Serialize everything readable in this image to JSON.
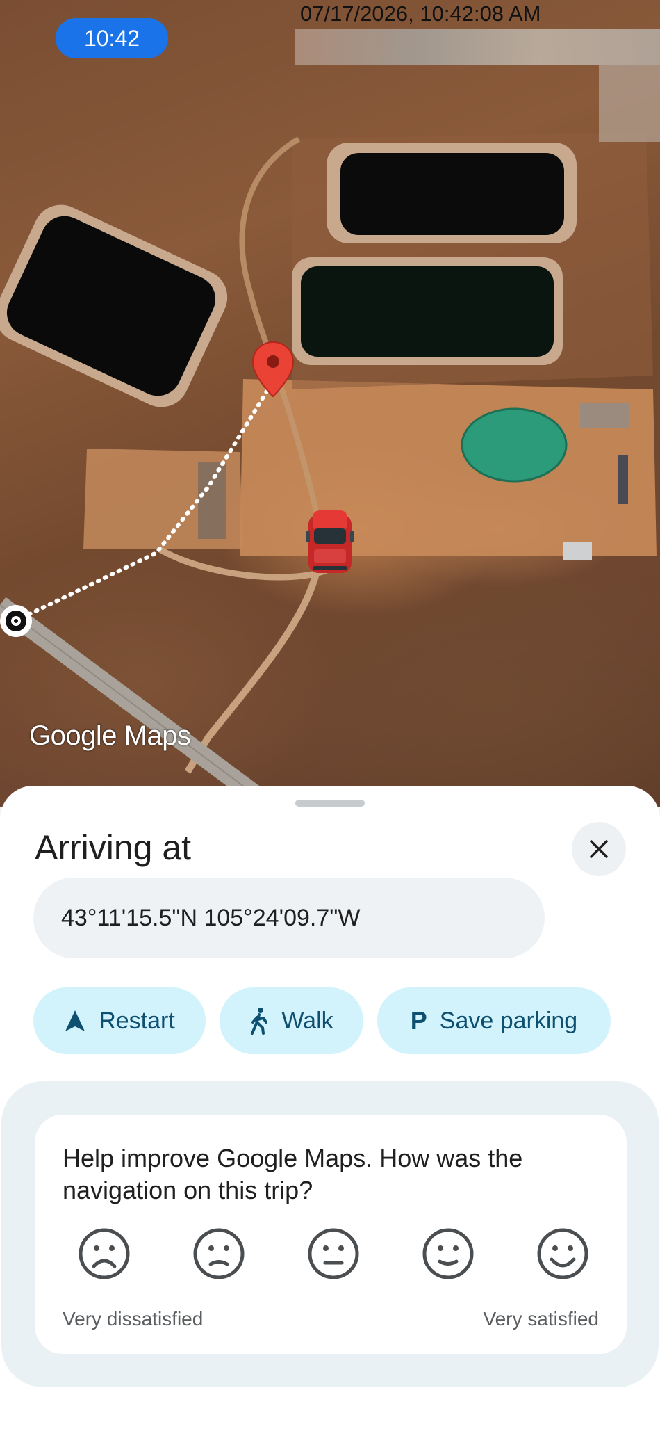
{
  "status_bar": {
    "time": "10:42"
  },
  "map": {
    "timestamp_overlay": "07/17/2026, 10:42:08 AM",
    "logo_text": "Google Maps"
  },
  "sheet": {
    "title": "Arriving at",
    "destination": "43°11'15.5\"N 105°24'09.7\"W",
    "actions": [
      {
        "label": "Restart",
        "icon": "navigation-arrow-icon"
      },
      {
        "label": "Walk",
        "icon": "walking-person-icon"
      },
      {
        "label": "Save parking",
        "icon": "parking-p-icon"
      }
    ],
    "feedback": {
      "question": "Help improve Google Maps. How was the navigation on this trip?",
      "low_label": "Very dissatisfied",
      "high_label": "Very satisfied",
      "scale": 5
    }
  },
  "colors": {
    "accent": "#1a73e8",
    "chip_bg": "#d3f3fc",
    "chip_text": "#0e5070",
    "pin": "#ea4335"
  }
}
